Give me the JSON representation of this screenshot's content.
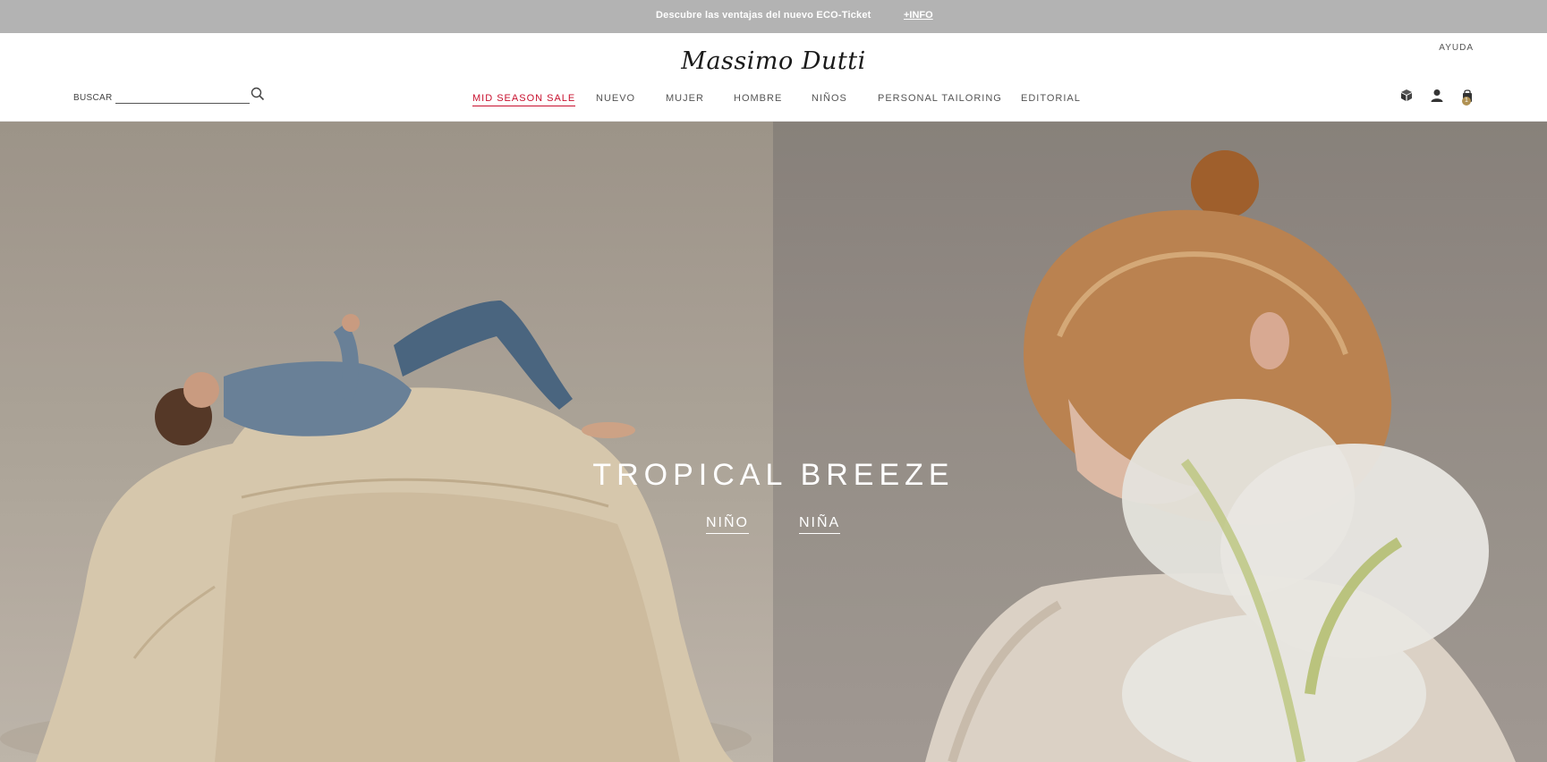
{
  "promo": {
    "text": "Descubre las ventajas del nuevo ECO-Ticket",
    "link": "+INFO"
  },
  "header": {
    "help": "AYUDA",
    "logo": "Massimo Dutti",
    "search": {
      "label": "BUSCAR",
      "value": "",
      "placeholder": ""
    },
    "nav": [
      {
        "label": "MID SEASON SALE",
        "active": true
      },
      {
        "label": "NUEVO"
      },
      {
        "label": "MUJER"
      },
      {
        "label": "HOMBRE"
      },
      {
        "label": "NIÑOS"
      },
      {
        "label": "PERSONAL TAILORING"
      },
      {
        "label": "EDITORIAL"
      }
    ],
    "icons": [
      "box-icon",
      "user-icon",
      "shopping-bag-icon"
    ],
    "cart_count": "1"
  },
  "hero": {
    "title": "TROPICAL BREEZE",
    "links": [
      {
        "label": "NIÑO"
      },
      {
        "label": "NIÑA"
      }
    ]
  },
  "colors": {
    "promo_bg": "#b3b3b3",
    "sale_red": "#c8102e",
    "badge_gold": "#b09152"
  }
}
